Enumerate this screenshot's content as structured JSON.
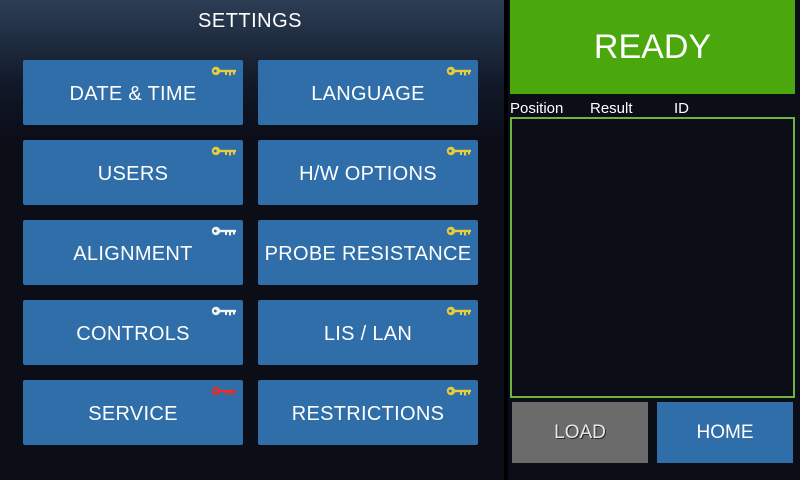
{
  "settings": {
    "title": "SETTINGS",
    "buttons": [
      {
        "id": "date-time",
        "label": "DATE & TIME",
        "key_color": "#e8cc3c"
      },
      {
        "id": "language",
        "label": "LANGUAGE",
        "key_color": "#e8cc3c"
      },
      {
        "id": "users",
        "label": "USERS",
        "key_color": "#e8cc3c"
      },
      {
        "id": "hw-options",
        "label": "H/W OPTIONS",
        "key_color": "#e8cc3c"
      },
      {
        "id": "alignment",
        "label": "ALIGNMENT",
        "key_color": "#f2f2f2"
      },
      {
        "id": "probe-resistance",
        "label": "PROBE RESISTANCE",
        "key_color": "#e8cc3c"
      },
      {
        "id": "controls",
        "label": "CONTROLS",
        "key_color": "#f2f2f2"
      },
      {
        "id": "lis-lan",
        "label": "LIS / LAN",
        "key_color": "#e8cc3c"
      },
      {
        "id": "service",
        "label": "SERVICE",
        "key_color": "#e0312f"
      },
      {
        "id": "restrictions",
        "label": "RESTRICTIONS",
        "key_color": "#e8cc3c"
      }
    ]
  },
  "status": {
    "text": "READY",
    "color": "#4aa80c"
  },
  "results": {
    "columns": [
      "Position",
      "Result",
      "ID"
    ],
    "rows": []
  },
  "actions": {
    "load_label": "LOAD",
    "home_label": "HOME"
  },
  "icons": {
    "key": "key-icon"
  }
}
